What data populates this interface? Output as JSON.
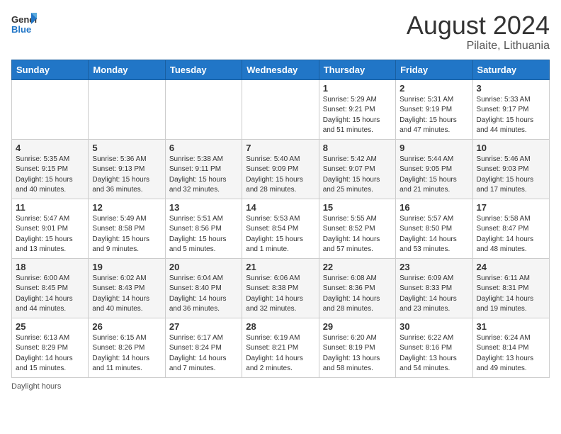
{
  "header": {
    "logo_general": "General",
    "logo_blue": "Blue",
    "month": "August 2024",
    "location": "Pilaite, Lithuania"
  },
  "days_of_week": [
    "Sunday",
    "Monday",
    "Tuesday",
    "Wednesday",
    "Thursday",
    "Friday",
    "Saturday"
  ],
  "weeks": [
    [
      {
        "day": "",
        "info": ""
      },
      {
        "day": "",
        "info": ""
      },
      {
        "day": "",
        "info": ""
      },
      {
        "day": "",
        "info": ""
      },
      {
        "day": "1",
        "info": "Sunrise: 5:29 AM\nSunset: 9:21 PM\nDaylight: 15 hours\nand 51 minutes."
      },
      {
        "day": "2",
        "info": "Sunrise: 5:31 AM\nSunset: 9:19 PM\nDaylight: 15 hours\nand 47 minutes."
      },
      {
        "day": "3",
        "info": "Sunrise: 5:33 AM\nSunset: 9:17 PM\nDaylight: 15 hours\nand 44 minutes."
      }
    ],
    [
      {
        "day": "4",
        "info": "Sunrise: 5:35 AM\nSunset: 9:15 PM\nDaylight: 15 hours\nand 40 minutes."
      },
      {
        "day": "5",
        "info": "Sunrise: 5:36 AM\nSunset: 9:13 PM\nDaylight: 15 hours\nand 36 minutes."
      },
      {
        "day": "6",
        "info": "Sunrise: 5:38 AM\nSunset: 9:11 PM\nDaylight: 15 hours\nand 32 minutes."
      },
      {
        "day": "7",
        "info": "Sunrise: 5:40 AM\nSunset: 9:09 PM\nDaylight: 15 hours\nand 28 minutes."
      },
      {
        "day": "8",
        "info": "Sunrise: 5:42 AM\nSunset: 9:07 PM\nDaylight: 15 hours\nand 25 minutes."
      },
      {
        "day": "9",
        "info": "Sunrise: 5:44 AM\nSunset: 9:05 PM\nDaylight: 15 hours\nand 21 minutes."
      },
      {
        "day": "10",
        "info": "Sunrise: 5:46 AM\nSunset: 9:03 PM\nDaylight: 15 hours\nand 17 minutes."
      }
    ],
    [
      {
        "day": "11",
        "info": "Sunrise: 5:47 AM\nSunset: 9:01 PM\nDaylight: 15 hours\nand 13 minutes."
      },
      {
        "day": "12",
        "info": "Sunrise: 5:49 AM\nSunset: 8:58 PM\nDaylight: 15 hours\nand 9 minutes."
      },
      {
        "day": "13",
        "info": "Sunrise: 5:51 AM\nSunset: 8:56 PM\nDaylight: 15 hours\nand 5 minutes."
      },
      {
        "day": "14",
        "info": "Sunrise: 5:53 AM\nSunset: 8:54 PM\nDaylight: 15 hours\nand 1 minute."
      },
      {
        "day": "15",
        "info": "Sunrise: 5:55 AM\nSunset: 8:52 PM\nDaylight: 14 hours\nand 57 minutes."
      },
      {
        "day": "16",
        "info": "Sunrise: 5:57 AM\nSunset: 8:50 PM\nDaylight: 14 hours\nand 53 minutes."
      },
      {
        "day": "17",
        "info": "Sunrise: 5:58 AM\nSunset: 8:47 PM\nDaylight: 14 hours\nand 48 minutes."
      }
    ],
    [
      {
        "day": "18",
        "info": "Sunrise: 6:00 AM\nSunset: 8:45 PM\nDaylight: 14 hours\nand 44 minutes."
      },
      {
        "day": "19",
        "info": "Sunrise: 6:02 AM\nSunset: 8:43 PM\nDaylight: 14 hours\nand 40 minutes."
      },
      {
        "day": "20",
        "info": "Sunrise: 6:04 AM\nSunset: 8:40 PM\nDaylight: 14 hours\nand 36 minutes."
      },
      {
        "day": "21",
        "info": "Sunrise: 6:06 AM\nSunset: 8:38 PM\nDaylight: 14 hours\nand 32 minutes."
      },
      {
        "day": "22",
        "info": "Sunrise: 6:08 AM\nSunset: 8:36 PM\nDaylight: 14 hours\nand 28 minutes."
      },
      {
        "day": "23",
        "info": "Sunrise: 6:09 AM\nSunset: 8:33 PM\nDaylight: 14 hours\nand 23 minutes."
      },
      {
        "day": "24",
        "info": "Sunrise: 6:11 AM\nSunset: 8:31 PM\nDaylight: 14 hours\nand 19 minutes."
      }
    ],
    [
      {
        "day": "25",
        "info": "Sunrise: 6:13 AM\nSunset: 8:29 PM\nDaylight: 14 hours\nand 15 minutes."
      },
      {
        "day": "26",
        "info": "Sunrise: 6:15 AM\nSunset: 8:26 PM\nDaylight: 14 hours\nand 11 minutes."
      },
      {
        "day": "27",
        "info": "Sunrise: 6:17 AM\nSunset: 8:24 PM\nDaylight: 14 hours\nand 7 minutes."
      },
      {
        "day": "28",
        "info": "Sunrise: 6:19 AM\nSunset: 8:21 PM\nDaylight: 14 hours\nand 2 minutes."
      },
      {
        "day": "29",
        "info": "Sunrise: 6:20 AM\nSunset: 8:19 PM\nDaylight: 13 hours\nand 58 minutes."
      },
      {
        "day": "30",
        "info": "Sunrise: 6:22 AM\nSunset: 8:16 PM\nDaylight: 13 hours\nand 54 minutes."
      },
      {
        "day": "31",
        "info": "Sunrise: 6:24 AM\nSunset: 8:14 PM\nDaylight: 13 hours\nand 49 minutes."
      }
    ]
  ],
  "footer": {
    "note": "Daylight hours"
  }
}
